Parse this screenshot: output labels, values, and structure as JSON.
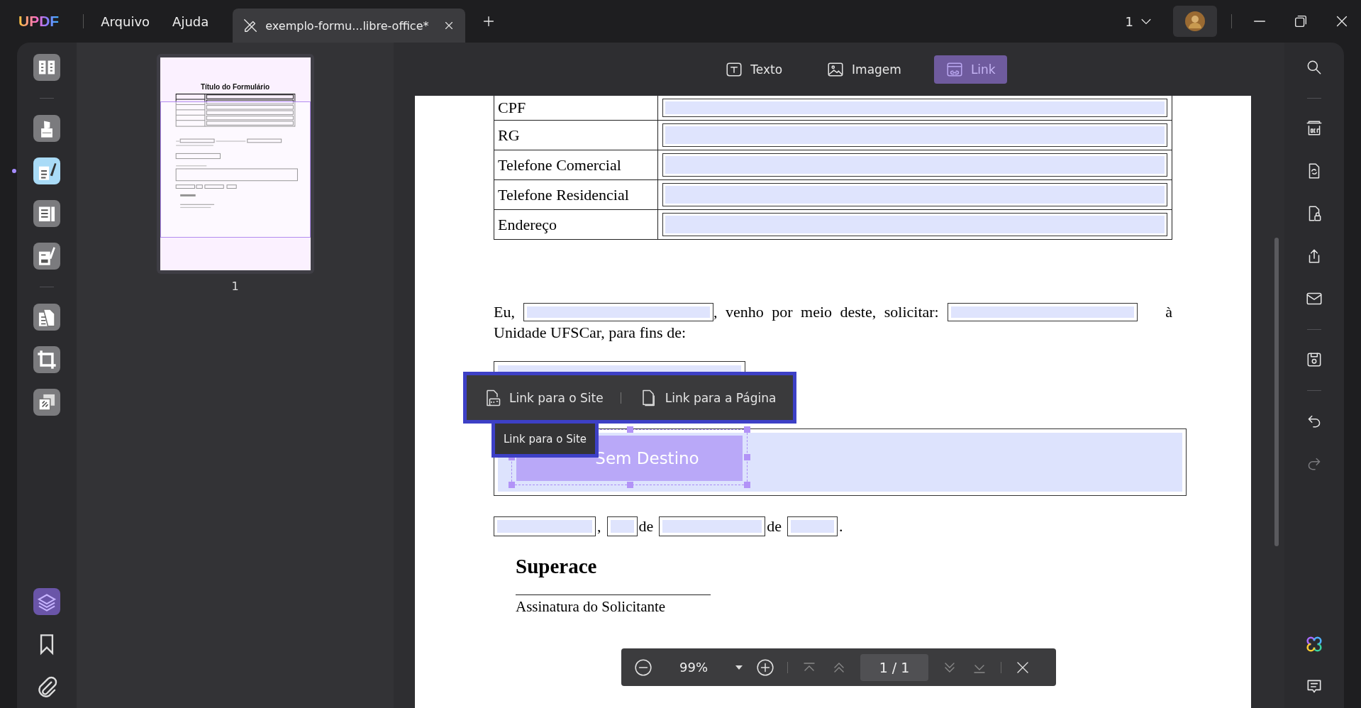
{
  "app": {
    "logo": "UPDF",
    "menus": [
      "Arquivo",
      "Ajuda"
    ]
  },
  "tabs": [
    {
      "title": "exemplo-formu...libre-office*",
      "selected": true
    }
  ],
  "topbar": {
    "page_count": "1"
  },
  "left_tools": [
    {
      "kind": "tool",
      "selected": false
    },
    {
      "kind": "separator"
    },
    {
      "kind": "tool",
      "selected": false
    },
    {
      "kind": "tool",
      "selected": true
    },
    {
      "kind": "tool",
      "selected": false
    },
    {
      "kind": "tool",
      "selected": false
    },
    {
      "kind": "separator"
    },
    {
      "kind": "tool",
      "selected": false
    },
    {
      "kind": "tool",
      "selected": false
    },
    {
      "kind": "tool",
      "selected": false
    }
  ],
  "left_bottom_tools": [
    {
      "selected": true
    },
    {
      "selected": false
    },
    {
      "selected": false
    }
  ],
  "thumbnail": {
    "title": "Título do Formulário",
    "page_label": "1"
  },
  "edit_toolbar": [
    {
      "label": "Texto",
      "selected": false
    },
    {
      "label": "Imagem",
      "selected": false
    },
    {
      "label": "Link",
      "selected": true
    }
  ],
  "document": {
    "table": [
      {
        "label": "CPF"
      },
      {
        "label": "RG"
      },
      {
        "label": "Telefone Comercial"
      },
      {
        "label": "Telefone Residencial"
      },
      {
        "label": "Endereço"
      }
    ],
    "request_lines": [
      [
        {
          "kind": "text",
          "text": "Eu,"
        },
        {
          "kind": "field"
        },
        {
          "kind": "text",
          "text": ", venho por meio deste, solicitar:"
        },
        {
          "kind": "field"
        },
        {
          "kind": "text",
          "text": "à"
        }
      ],
      [
        {
          "kind": "text",
          "text": "Unidade UFSCar, para fins de:"
        }
      ]
    ],
    "link_annotation": {
      "label": "Sem Destino",
      "selected": true
    },
    "date_line": [
      {
        "kind": "field"
      },
      {
        "kind": "text",
        "text": ","
      },
      {
        "kind": "field"
      },
      {
        "kind": "text",
        "text": "de"
      },
      {
        "kind": "field"
      },
      {
        "kind": "text",
        "text": "de"
      },
      {
        "kind": "field"
      },
      {
        "kind": "text",
        "text": "."
      }
    ],
    "company": "Superace",
    "signature_label": "Assinatura do Solicitante"
  },
  "link_menu": {
    "options": [
      {
        "label": "Link para o Site"
      },
      {
        "label": "Link para a Página"
      }
    ],
    "tooltip": "Link para o Site"
  },
  "zoom_bar": {
    "zoom": "99%",
    "page": "1 / 1"
  },
  "right_tools": [
    {
      "kind": "tool",
      "disabled": false
    },
    {
      "kind": "separator"
    },
    {
      "kind": "tool",
      "disabled": false
    },
    {
      "kind": "tool",
      "disabled": false
    },
    {
      "kind": "tool",
      "disabled": false
    },
    {
      "kind": "tool",
      "disabled": false
    },
    {
      "kind": "tool",
      "disabled": false
    },
    {
      "kind": "separator"
    },
    {
      "kind": "tool",
      "disabled": false
    },
    {
      "kind": "separator"
    },
    {
      "kind": "tool",
      "disabled": false
    },
    {
      "kind": "tool",
      "disabled": true
    }
  ]
}
